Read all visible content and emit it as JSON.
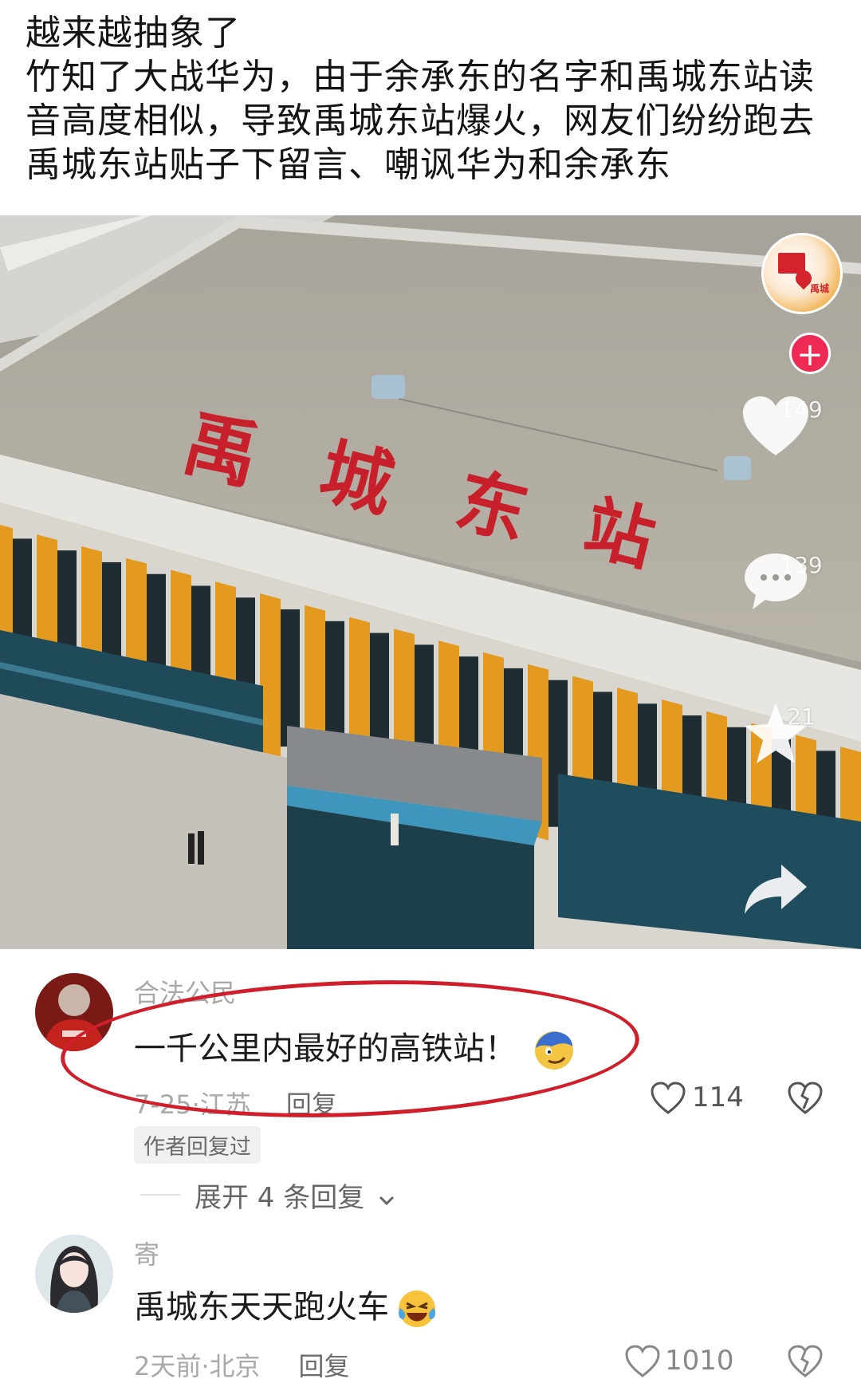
{
  "post": {
    "caption_lines": [
      "越来越抽象了",
      "竹知了大战华为，由于余承东的名字和禹城东站读",
      "音高度相似，导致禹城东站爆火，网友们纷纷跑去",
      "禹城东站贴子下留言、嘲讽华为和余承东"
    ]
  },
  "video": {
    "station_sign": [
      "禹",
      "城",
      "东",
      "站"
    ],
    "account_logo_text": "禹城",
    "follow_label": "+",
    "likes": "149",
    "comments": "139",
    "favorites": "21"
  },
  "comments": [
    {
      "name": "合法公民",
      "text": "一千公里内最好的高铁站！",
      "date_location": "7-25·江苏",
      "reply_label": "回复",
      "likes": "114",
      "author_badge": "作者回复过",
      "expand_label": "展开 4 条回复"
    },
    {
      "name": "寄",
      "text": "禹城东天天跑火车",
      "date_location": "2天前·北京",
      "reply_label": "回复",
      "likes": "1010"
    }
  ],
  "icons": {
    "like": "heart-icon",
    "comment": "comment-bubble-icon",
    "favorite": "star-icon",
    "share": "share-arrow-icon",
    "comment_like": "heart-outline-icon",
    "comment_dislike": "broken-heart-icon",
    "expand": "chevron-down-icon",
    "emoji_1": "smirking-face-emoji",
    "emoji_2": "laughing-crying-emoji"
  },
  "colors": {
    "accent_red": "#d01e2b",
    "follow_pink": "#ee2a54",
    "sign_red": "#c8202a",
    "facade_orange": "#e39a1e"
  }
}
